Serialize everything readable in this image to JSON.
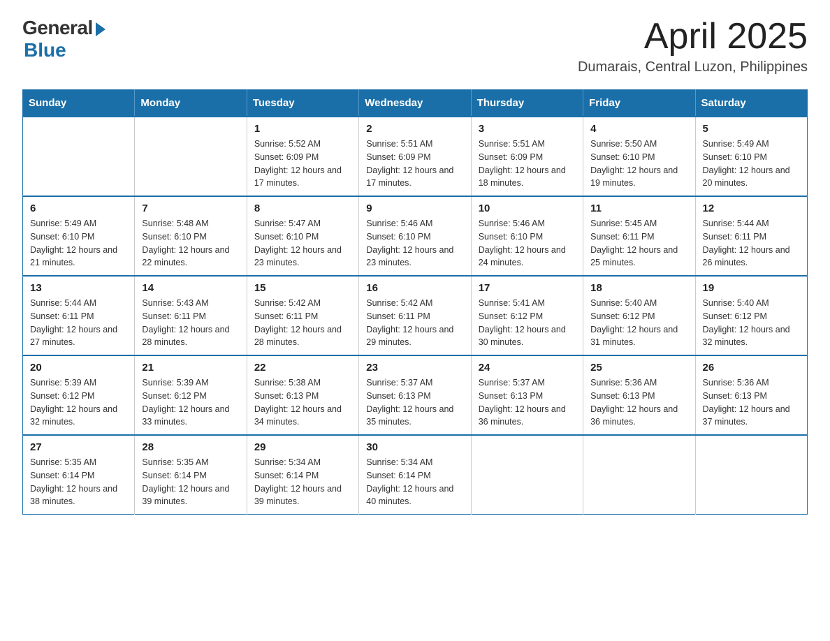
{
  "header": {
    "logo_general": "General",
    "logo_blue": "Blue",
    "month_title": "April 2025",
    "location": "Dumarais, Central Luzon, Philippines"
  },
  "weekdays": [
    "Sunday",
    "Monday",
    "Tuesday",
    "Wednesday",
    "Thursday",
    "Friday",
    "Saturday"
  ],
  "weeks": [
    [
      {
        "day": "",
        "info": ""
      },
      {
        "day": "",
        "info": ""
      },
      {
        "day": "1",
        "info": "Sunrise: 5:52 AM\nSunset: 6:09 PM\nDaylight: 12 hours\nand 17 minutes."
      },
      {
        "day": "2",
        "info": "Sunrise: 5:51 AM\nSunset: 6:09 PM\nDaylight: 12 hours\nand 17 minutes."
      },
      {
        "day": "3",
        "info": "Sunrise: 5:51 AM\nSunset: 6:09 PM\nDaylight: 12 hours\nand 18 minutes."
      },
      {
        "day": "4",
        "info": "Sunrise: 5:50 AM\nSunset: 6:10 PM\nDaylight: 12 hours\nand 19 minutes."
      },
      {
        "day": "5",
        "info": "Sunrise: 5:49 AM\nSunset: 6:10 PM\nDaylight: 12 hours\nand 20 minutes."
      }
    ],
    [
      {
        "day": "6",
        "info": "Sunrise: 5:49 AM\nSunset: 6:10 PM\nDaylight: 12 hours\nand 21 minutes."
      },
      {
        "day": "7",
        "info": "Sunrise: 5:48 AM\nSunset: 6:10 PM\nDaylight: 12 hours\nand 22 minutes."
      },
      {
        "day": "8",
        "info": "Sunrise: 5:47 AM\nSunset: 6:10 PM\nDaylight: 12 hours\nand 23 minutes."
      },
      {
        "day": "9",
        "info": "Sunrise: 5:46 AM\nSunset: 6:10 PM\nDaylight: 12 hours\nand 23 minutes."
      },
      {
        "day": "10",
        "info": "Sunrise: 5:46 AM\nSunset: 6:10 PM\nDaylight: 12 hours\nand 24 minutes."
      },
      {
        "day": "11",
        "info": "Sunrise: 5:45 AM\nSunset: 6:11 PM\nDaylight: 12 hours\nand 25 minutes."
      },
      {
        "day": "12",
        "info": "Sunrise: 5:44 AM\nSunset: 6:11 PM\nDaylight: 12 hours\nand 26 minutes."
      }
    ],
    [
      {
        "day": "13",
        "info": "Sunrise: 5:44 AM\nSunset: 6:11 PM\nDaylight: 12 hours\nand 27 minutes."
      },
      {
        "day": "14",
        "info": "Sunrise: 5:43 AM\nSunset: 6:11 PM\nDaylight: 12 hours\nand 28 minutes."
      },
      {
        "day": "15",
        "info": "Sunrise: 5:42 AM\nSunset: 6:11 PM\nDaylight: 12 hours\nand 28 minutes."
      },
      {
        "day": "16",
        "info": "Sunrise: 5:42 AM\nSunset: 6:11 PM\nDaylight: 12 hours\nand 29 minutes."
      },
      {
        "day": "17",
        "info": "Sunrise: 5:41 AM\nSunset: 6:12 PM\nDaylight: 12 hours\nand 30 minutes."
      },
      {
        "day": "18",
        "info": "Sunrise: 5:40 AM\nSunset: 6:12 PM\nDaylight: 12 hours\nand 31 minutes."
      },
      {
        "day": "19",
        "info": "Sunrise: 5:40 AM\nSunset: 6:12 PM\nDaylight: 12 hours\nand 32 minutes."
      }
    ],
    [
      {
        "day": "20",
        "info": "Sunrise: 5:39 AM\nSunset: 6:12 PM\nDaylight: 12 hours\nand 32 minutes."
      },
      {
        "day": "21",
        "info": "Sunrise: 5:39 AM\nSunset: 6:12 PM\nDaylight: 12 hours\nand 33 minutes."
      },
      {
        "day": "22",
        "info": "Sunrise: 5:38 AM\nSunset: 6:13 PM\nDaylight: 12 hours\nand 34 minutes."
      },
      {
        "day": "23",
        "info": "Sunrise: 5:37 AM\nSunset: 6:13 PM\nDaylight: 12 hours\nand 35 minutes."
      },
      {
        "day": "24",
        "info": "Sunrise: 5:37 AM\nSunset: 6:13 PM\nDaylight: 12 hours\nand 36 minutes."
      },
      {
        "day": "25",
        "info": "Sunrise: 5:36 AM\nSunset: 6:13 PM\nDaylight: 12 hours\nand 36 minutes."
      },
      {
        "day": "26",
        "info": "Sunrise: 5:36 AM\nSunset: 6:13 PM\nDaylight: 12 hours\nand 37 minutes."
      }
    ],
    [
      {
        "day": "27",
        "info": "Sunrise: 5:35 AM\nSunset: 6:14 PM\nDaylight: 12 hours\nand 38 minutes."
      },
      {
        "day": "28",
        "info": "Sunrise: 5:35 AM\nSunset: 6:14 PM\nDaylight: 12 hours\nand 39 minutes."
      },
      {
        "day": "29",
        "info": "Sunrise: 5:34 AM\nSunset: 6:14 PM\nDaylight: 12 hours\nand 39 minutes."
      },
      {
        "day": "30",
        "info": "Sunrise: 5:34 AM\nSunset: 6:14 PM\nDaylight: 12 hours\nand 40 minutes."
      },
      {
        "day": "",
        "info": ""
      },
      {
        "day": "",
        "info": ""
      },
      {
        "day": "",
        "info": ""
      }
    ]
  ]
}
